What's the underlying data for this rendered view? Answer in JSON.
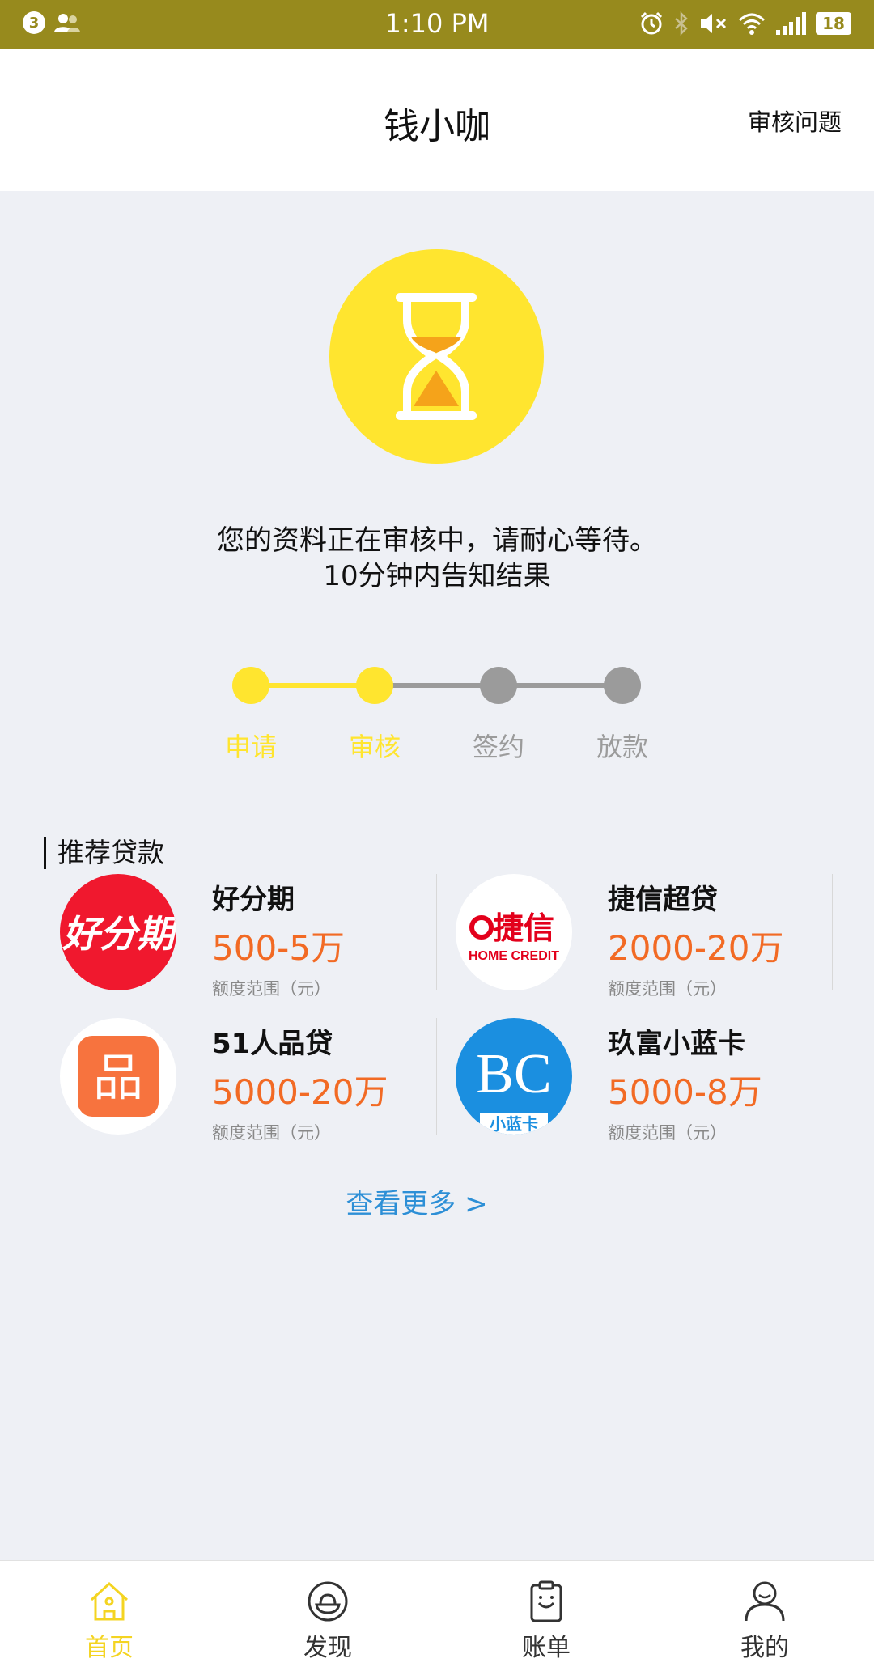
{
  "status_bar": {
    "notification_count": "3",
    "time": "1:10 PM",
    "battery": "18"
  },
  "header": {
    "title": "钱小咖",
    "action": "审核问题"
  },
  "status": {
    "line1": "您的资料正在审核中，请耐心等待。",
    "line2": "10分钟内告知结果"
  },
  "progress": {
    "current_step": 2,
    "steps": [
      "申请",
      "审核",
      "签约",
      "放款"
    ]
  },
  "recommend": {
    "title": "推荐贷款",
    "products": [
      {
        "name": "好分期",
        "amount": "500-5万",
        "range_label": "额度范围（元）",
        "logo": "haofenqi-logo",
        "logo_text": "好分期"
      },
      {
        "name": "捷信超贷",
        "amount": "2000-20万",
        "range_label": "额度范围（元）",
        "logo": "home-credit-logo",
        "logo_text": "捷信",
        "logo_subtext": "HOME CREDIT"
      },
      {
        "name": "51人品贷",
        "amount": "5000-20万",
        "range_label": "额度范围（元）",
        "logo": "51renpin-logo",
        "logo_text": "品"
      },
      {
        "name": "玖富小蓝卡",
        "amount": "5000-8万",
        "range_label": "额度范围（元）",
        "logo": "jiufu-bluecard-logo",
        "logo_text": "BC",
        "logo_subtext": "小蓝卡"
      }
    ],
    "more": "查看更多 >"
  },
  "tabbar": {
    "tabs": [
      {
        "label": "首页",
        "icon": "home-icon",
        "active": true
      },
      {
        "label": "发现",
        "icon": "discover-icon",
        "active": false
      },
      {
        "label": "账单",
        "icon": "bill-icon",
        "active": false
      },
      {
        "label": "我的",
        "icon": "profile-icon",
        "active": false
      }
    ]
  },
  "colors": {
    "status_bar": "#978a1d",
    "accent_yellow": "#ffe52f",
    "amount_orange": "#f26a24",
    "link_blue": "#2d8fd6",
    "inactive_gray": "#9b9b9b"
  }
}
